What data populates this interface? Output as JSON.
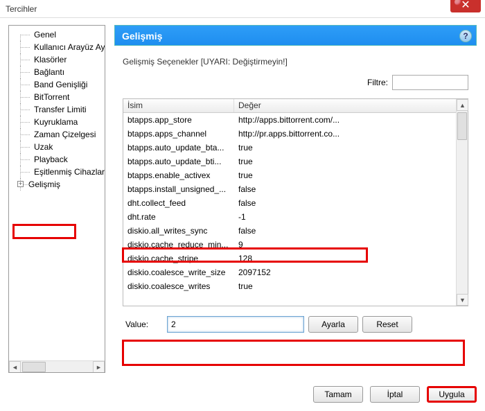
{
  "window": {
    "title": "Tercihler"
  },
  "sidebar": {
    "items": [
      {
        "label": "Genel"
      },
      {
        "label": "Kullanıcı Arayüz Ay"
      },
      {
        "label": "Klasörler"
      },
      {
        "label": "Bağlantı"
      },
      {
        "label": "Band Genişliği"
      },
      {
        "label": "BitTorrent"
      },
      {
        "label": "Transfer Limiti"
      },
      {
        "label": "Kuyruklama"
      },
      {
        "label": "Zaman Çizelgesi"
      },
      {
        "label": "Uzak"
      },
      {
        "label": "Playback"
      },
      {
        "label": "Eşitlenmiş Cihazlar"
      },
      {
        "label": "Gelişmiş",
        "expandable": true,
        "selected": true
      }
    ]
  },
  "panel": {
    "title": "Gelişmiş",
    "warning": "Gelişmiş Seçenekler [UYARI: Değiştirmeyin!]",
    "filter_label": "Filtre:",
    "filter_value": ""
  },
  "table": {
    "headers": {
      "name": "İsim",
      "value": "Değer"
    },
    "rows": [
      {
        "name": "btapps.app_store",
        "value": "http://apps.bittorrent.com/..."
      },
      {
        "name": "btapps.apps_channel",
        "value": "http://pr.apps.bittorrent.co..."
      },
      {
        "name": "btapps.auto_update_bta...",
        "value": "true"
      },
      {
        "name": "btapps.auto_update_bti...",
        "value": "true"
      },
      {
        "name": "btapps.enable_activex",
        "value": "true"
      },
      {
        "name": "btapps.install_unsigned_...",
        "value": "false"
      },
      {
        "name": "dht.collect_feed",
        "value": "false"
      },
      {
        "name": "dht.rate",
        "value": "-1",
        "highlight": true
      },
      {
        "name": "diskio.all_writes_sync",
        "value": "false"
      },
      {
        "name": "diskio.cache_reduce_min...",
        "value": "9"
      },
      {
        "name": "diskio.cache_stripe",
        "value": "128"
      },
      {
        "name": "diskio.coalesce_write_size",
        "value": "2097152"
      },
      {
        "name": "diskio.coalesce_writes",
        "value": "true"
      }
    ]
  },
  "value_editor": {
    "label": "Value:",
    "value": "2",
    "set_btn": "Ayarla",
    "reset_btn": "Reset"
  },
  "dialog_buttons": {
    "ok": "Tamam",
    "cancel": "İptal",
    "apply": "Uygula"
  }
}
